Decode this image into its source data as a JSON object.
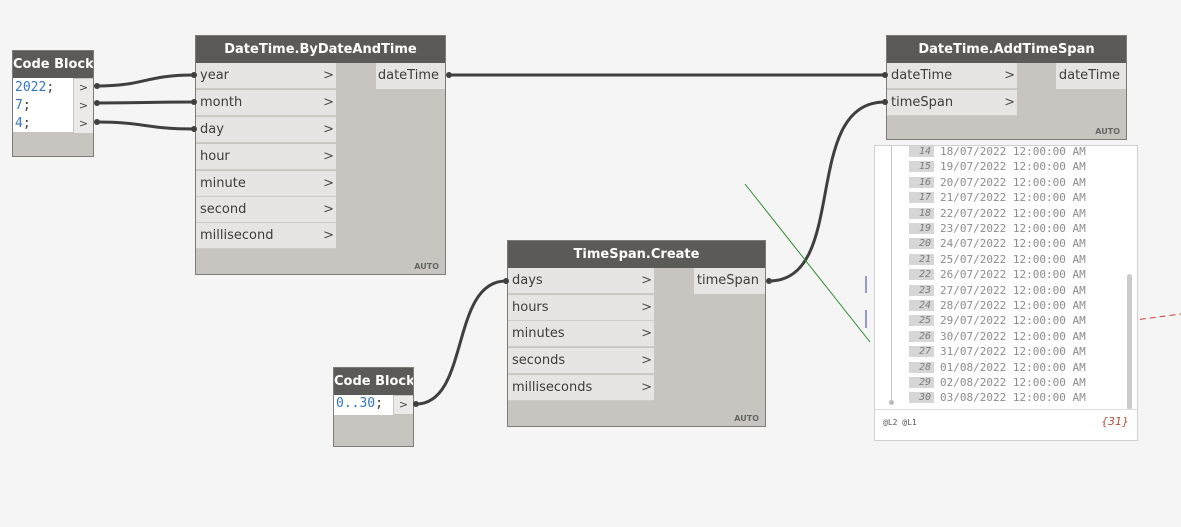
{
  "nodes": {
    "cb_date": {
      "title": "Code Block",
      "lines": [
        {
          "value": "2022",
          "suffix": ";"
        },
        {
          "value": "7",
          "suffix": ";"
        },
        {
          "value": "4",
          "suffix": ";"
        }
      ],
      "out_glyph": ">"
    },
    "bydate": {
      "title": "DateTime.ByDateAndTime",
      "inputs": [
        "year",
        "month",
        "day",
        "hour",
        "minute",
        "second",
        "millisecond"
      ],
      "output": "dateTime",
      "lacing": "AUTO"
    },
    "addspan": {
      "title": "DateTime.AddTimeSpan",
      "inputs": [
        "dateTime",
        "timeSpan"
      ],
      "output": "dateTime",
      "lacing": "AUTO"
    },
    "tscreate": {
      "title": "TimeSpan.Create",
      "inputs": [
        "days",
        "hours",
        "minutes",
        "seconds",
        "milliseconds"
      ],
      "output": "timeSpan",
      "lacing": "AUTO"
    },
    "cb_range": {
      "title": "Code Block",
      "code_num": "0..30",
      "code_suffix": ";",
      "out_glyph": ">"
    }
  },
  "port_chevron": ">",
  "preview": {
    "rows": [
      {
        "idx": "14",
        "val": "18/07/2022 12:00:00 AM"
      },
      {
        "idx": "15",
        "val": "19/07/2022 12:00:00 AM"
      },
      {
        "idx": "16",
        "val": "20/07/2022 12:00:00 AM"
      },
      {
        "idx": "17",
        "val": "21/07/2022 12:00:00 AM"
      },
      {
        "idx": "18",
        "val": "22/07/2022 12:00:00 AM"
      },
      {
        "idx": "19",
        "val": "23/07/2022 12:00:00 AM"
      },
      {
        "idx": "20",
        "val": "24/07/2022 12:00:00 AM"
      },
      {
        "idx": "21",
        "val": "25/07/2022 12:00:00 AM"
      },
      {
        "idx": "22",
        "val": "26/07/2022 12:00:00 AM"
      },
      {
        "idx": "23",
        "val": "27/07/2022 12:00:00 AM"
      },
      {
        "idx": "24",
        "val": "28/07/2022 12:00:00 AM"
      },
      {
        "idx": "25",
        "val": "29/07/2022 12:00:00 AM"
      },
      {
        "idx": "26",
        "val": "30/07/2022 12:00:00 AM"
      },
      {
        "idx": "27",
        "val": "31/07/2022 12:00:00 AM"
      },
      {
        "idx": "28",
        "val": "01/08/2022 12:00:00 AM"
      },
      {
        "idx": "29",
        "val": "02/08/2022 12:00:00 AM"
      },
      {
        "idx": "30",
        "val": "03/08/2022 12:00:00 AM"
      }
    ],
    "levels": "@L2 @L1",
    "count": "{31}"
  },
  "colors": {
    "canvas": "#f5f5f5",
    "node_header": "#5b5a58",
    "node_body": "#c8c5c0",
    "wire": "#3f3f3f",
    "number": "#3575c0"
  }
}
